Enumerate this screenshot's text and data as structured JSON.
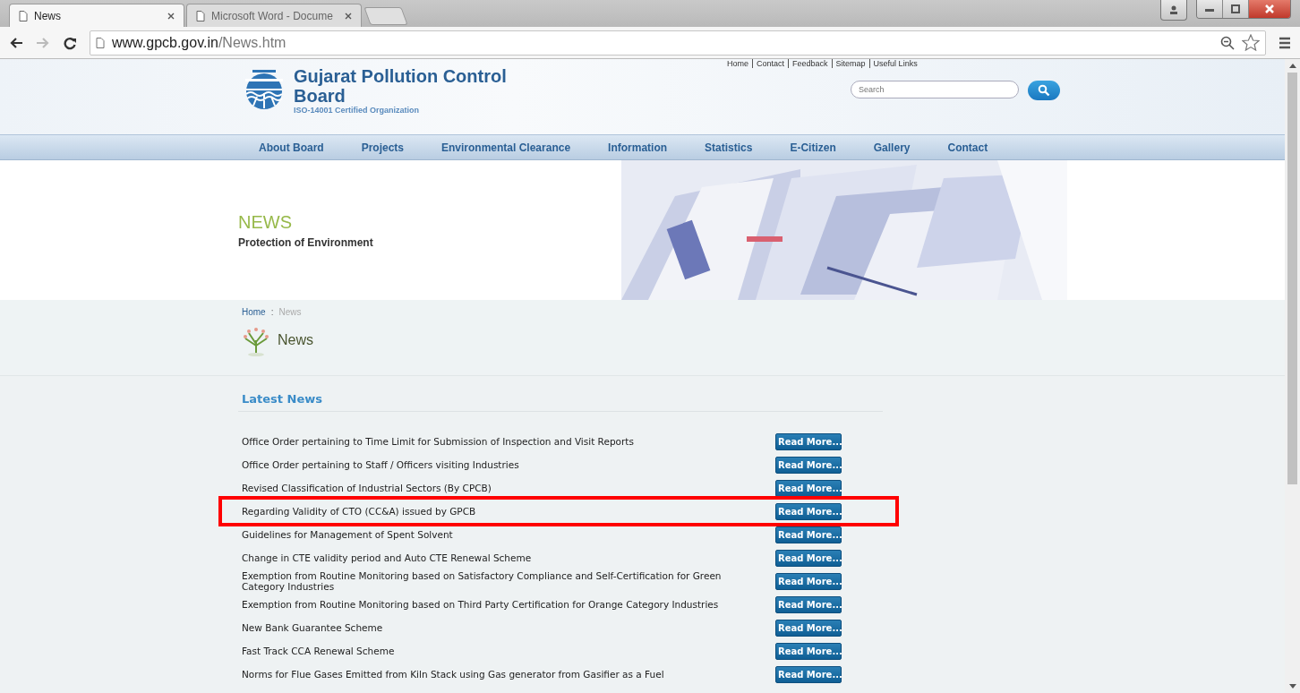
{
  "browser": {
    "tabs": [
      {
        "title": "News",
        "selected": true
      },
      {
        "title": "Microsoft Word - Docume",
        "selected": false
      }
    ],
    "url_host": "www.gpcb.gov.in",
    "url_path": "/News.htm"
  },
  "header": {
    "org_name": "Gujarat Pollution Control Board",
    "tagline": "ISO-14001 Certified Organization",
    "top_links": [
      "Home",
      "Contact",
      "Feedback",
      "Sitemap",
      "Useful Links"
    ],
    "search": {
      "placeholder": "Search"
    }
  },
  "nav": [
    "About Board",
    "Projects",
    "Environmental Clearance",
    "Information",
    "Statistics",
    "E-Citizen",
    "Gallery",
    "Contact"
  ],
  "banner": {
    "title": "NEWS",
    "subtitle": "Protection of Environment",
    "kind": "picture"
  },
  "breadcrumb": [
    {
      "label": "Home",
      "current": false
    },
    {
      "label": "News",
      "current": true
    }
  ],
  "breadcrumb_separator": ":",
  "page_title": "News",
  "section_title": "Latest News",
  "news": [
    {
      "title": "Office Order pertaining to Time Limit for Submission of Inspection and Visit Reports",
      "button": "Read More...",
      "highlighted": false
    },
    {
      "title": "Office Order pertaining to Staff / Officers visiting Industries",
      "button": "Read More...",
      "highlighted": false
    },
    {
      "title": "Revised Classification of Industrial Sectors (By CPCB)",
      "button": "Read More...",
      "highlighted": false
    },
    {
      "title": "Regarding Validity of CTO (CC&A) issued by GPCB",
      "button": "Read More...",
      "highlighted": true
    },
    {
      "title": "Guidelines for Management of Spent Solvent",
      "button": "Read More...",
      "highlighted": false
    },
    {
      "title": "Change in CTE validity period and Auto CTE Renewal Scheme",
      "button": "Read More...",
      "highlighted": false
    },
    {
      "title": "Exemption from Routine Monitoring based on Satisfactory Compliance and Self-Certification for Green Category Industries",
      "button": "Read More...",
      "highlighted": false
    },
    {
      "title": "Exemption from Routine Monitoring based on Third Party Certification for Orange Category Industries",
      "button": "Read More...",
      "highlighted": false
    },
    {
      "title": "New Bank Guarantee Scheme",
      "button": "Read More...",
      "highlighted": false
    },
    {
      "title": "Fast Track CCA Renewal Scheme",
      "button": "Read More...",
      "highlighted": false
    },
    {
      "title": "Norms for Flue Gases Emitted from Kiln Stack using Gas generator from Gasifier as a Fuel",
      "button": "Read More...",
      "highlighted": false
    }
  ]
}
